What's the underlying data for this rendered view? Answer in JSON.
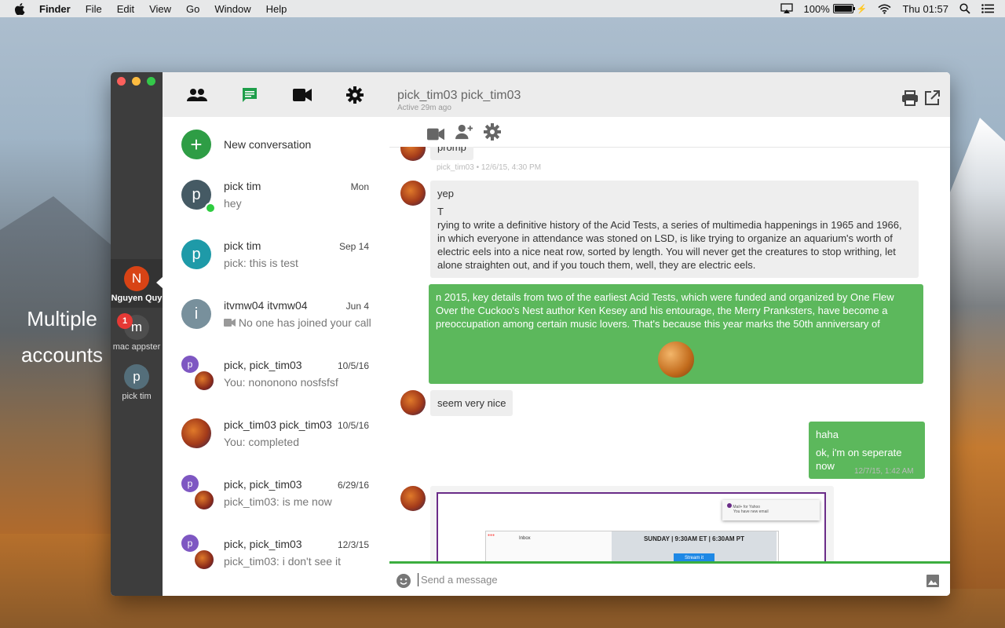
{
  "menubar": {
    "app": "Finder",
    "items": [
      "File",
      "Edit",
      "View",
      "Go",
      "Window",
      "Help"
    ],
    "battery": "100%",
    "clock": "Thu 01:57"
  },
  "desktop": {
    "label_line1": "Multiple",
    "label_line2": "accounts"
  },
  "accounts": [
    {
      "initial": "N",
      "name": "Nguyen Quy",
      "color": "#d84315",
      "active": true
    },
    {
      "initial": "m",
      "name": "mac appster",
      "color": "#4e4e4e",
      "badge": "1"
    },
    {
      "initial": "p",
      "name": "pick tim",
      "color": "#546e7a"
    }
  ],
  "new_conversation": {
    "label": "New conversation",
    "icon": "+"
  },
  "conversations": [
    {
      "title": "pick tim",
      "date": "Mon",
      "preview": "hey",
      "initial": "p",
      "color": "#455a64",
      "online": true
    },
    {
      "title": "pick tim",
      "date": "Sep 14",
      "preview": "pick: this is test",
      "initial": "p",
      "color": "#1e9aa8"
    },
    {
      "title": "itvmw04 itvmw04",
      "date": "Jun 4",
      "preview": "No one has joined your call",
      "initial": "i",
      "color": "#78909c"
    },
    {
      "title": "pick, pick_tim03",
      "date": "10/5/16",
      "preview": "You: nononono nosfsfsf",
      "initial": "p",
      "color": "#7e57c2"
    },
    {
      "title": "pick_tim03 pick_tim03",
      "date": "10/5/16",
      "preview": "You: completed"
    },
    {
      "title": "pick, pick_tim03",
      "date": "6/29/16",
      "preview": "pick_tim03: is me now",
      "initial": "p",
      "color": "#7e57c2"
    },
    {
      "title": "pick, pick_tim03",
      "date": "12/3/15",
      "preview": "pick_tim03: i don't see it",
      "initial": "p",
      "color": "#7e57c2"
    }
  ],
  "chat": {
    "title": "pick_tim03 pick_tim03",
    "status": "Active 29m ago",
    "messages": {
      "m1_text": "promp",
      "m1_meta": "pick_tim03 • 12/6/15, 4:30 PM",
      "m2_line1": "yep",
      "m2_line2": "T",
      "m2_line3": "rying to write a definitive history of the Acid Tests, a series of multimedia happenings in 1965 and 1966, in which everyone in attendance was stoned on LSD, is like trying to organize an aquarium's worth of electric eels into a nice neat row, sorted by length. You will never get the creatures to stop writhing, let alone straighten out, and if you touch them, well, they are electric eels.",
      "m3_text": "n 2015, key details from two of the earliest Acid Tests, which were funded and organized by One Flew Over the Cuckoo's Nest author Ken Kesey and his entourage, the Merry Pranksters, have become a preoccupation among certain music lovers. That's because this year marks the 50th anniversary of",
      "m4_text": "seem very nice",
      "m5_line1": "haha",
      "m5_line2": "ok, i'm on seperate now",
      "m5_meta": "12/7/15, 1:42 AM"
    },
    "screenshot": {
      "inbox": "Inbox",
      "event": "SUNDAY | 9:30AM ET | 6:30AM PT",
      "stream": "Stream it",
      "notif_title": "Mail+ for Yahoo",
      "notif_body": "You have new email"
    },
    "composer_placeholder": "Send a message"
  }
}
